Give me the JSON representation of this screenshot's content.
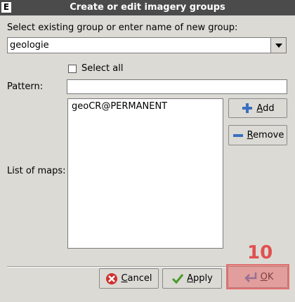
{
  "window": {
    "title": "Create or edit imagery groups",
    "icon": "E"
  },
  "group_prompt": "Select existing group or enter name of new group:",
  "group_value": "geologie",
  "select_all_label": "Select all",
  "pattern_label": "Pattern:",
  "pattern_value": "",
  "list_label": "List of maps:",
  "maps": [
    "geoCR@PERMANENT"
  ],
  "buttons": {
    "add": "Add",
    "remove": "Remove",
    "cancel": "Cancel",
    "apply": "Apply",
    "ok": "OK"
  },
  "annotation": {
    "step": "10",
    "color": "#e05050"
  }
}
